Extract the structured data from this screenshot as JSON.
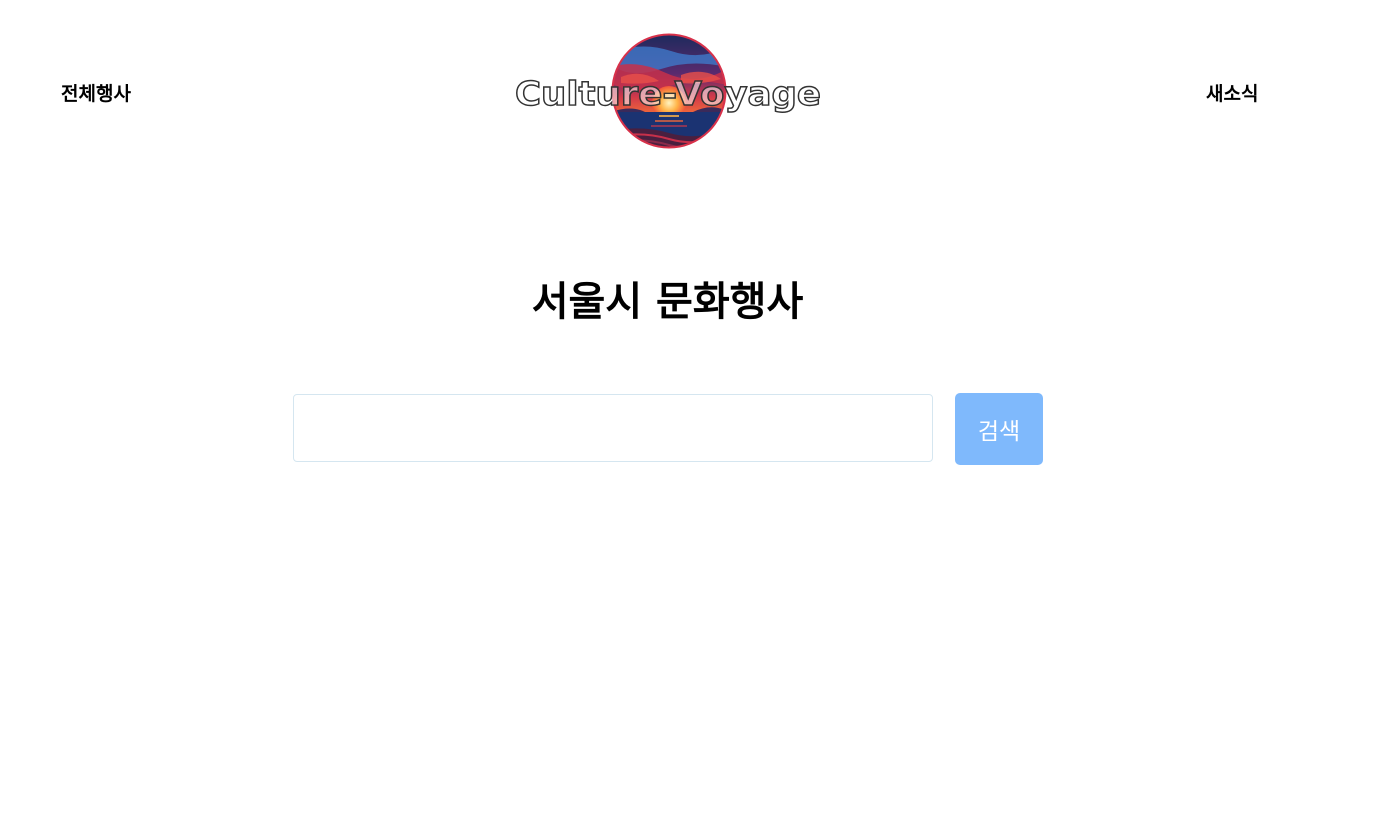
{
  "header": {
    "nav_all_events": "전체행사",
    "nav_news": "새소식",
    "logo_text": "Culture-Voyage"
  },
  "main": {
    "title": "서울시 문화행사",
    "search": {
      "value": "",
      "placeholder": "",
      "button_label": "검색"
    }
  },
  "colors": {
    "search_button_bg": "#7fb9fc",
    "input_border": "#d5e6f0"
  }
}
